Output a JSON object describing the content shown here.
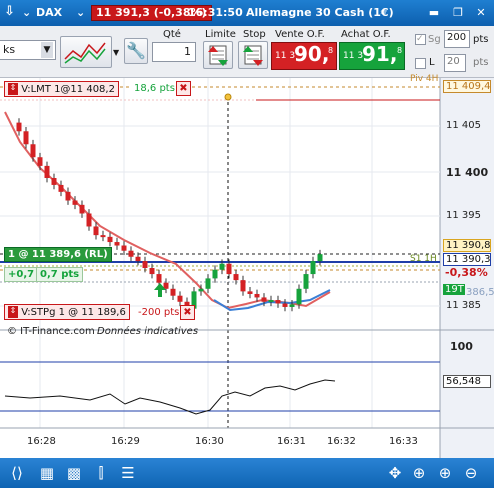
{
  "titlebar": {
    "symbol": "DAX",
    "quote": "11 391,3 (-0,38%)",
    "time": "16:31:50",
    "instrument": "Allemagne 30 Cash (1€)"
  },
  "toolbar": {
    "timeframe_value": "ks",
    "qty_label": "Qté",
    "qty_value": "1",
    "limit_label": "Limite",
    "stop_label": "Stop",
    "sell_label": "Vente O.F.",
    "buy_label": "Achat O.F.",
    "sell_price_small": "11 3",
    "sell_price_big": "90,",
    "sell_price_sup": "8",
    "buy_price_small": "11 3",
    "buy_price_big": "91,",
    "buy_price_sup": "8",
    "sg_label": "Sg",
    "sg_value": "200",
    "sg_unit": "pts",
    "l_label": "L",
    "l_value": "20",
    "l_unit": "pts"
  },
  "orders": {
    "limit_order": "V:LMT  1@11 408,2",
    "limit_pts": "18,6 pts",
    "position": "1 @ 11 389,6 (RL)",
    "position_pl": "+0,7",
    "position_pts": "0,7 pts",
    "stop_order": "V:STPg  1 @ 11 189,6",
    "stop_pts": "-200 pts"
  },
  "chart_labels": {
    "piv_label": "Piv 4H",
    "piv_value": "11 409,4",
    "s1_label": "S1 1H",
    "price_last": "11 390,8",
    "price_close": "11 390,3",
    "pct_change": "-0,38%",
    "timer": "19T",
    "s1_value": "386,5",
    "copyright": "© IT-Finance.com",
    "disclaimer": "Données indicatives",
    "osc_top": "100",
    "osc_value": "56,548"
  },
  "y_axis": [
    "11 405",
    "11 400",
    "11 395",
    "11 385"
  ],
  "x_axis": [
    "16:28",
    "16:29",
    "16:30",
    "16:31",
    "16:32",
    "16:33"
  ],
  "colors": {
    "up": "#16a33c",
    "down": "#d42124",
    "titlebar": "#1373c6"
  },
  "chart_data": {
    "type": "candlestick",
    "ylim": [
      11382.5,
      11410
    ],
    "x": [
      "16:28",
      "16:29",
      "16:30",
      "16:31",
      "16:32",
      "16:33"
    ],
    "last_price": 11390.3,
    "pivot_4h": 11409.4,
    "limit_order": 11408.2,
    "position_entry": 11389.6,
    "series": [
      {
        "name": "price",
        "values": [
          11406,
          11405,
          11403.5,
          11402,
          11401,
          11399.6,
          11398.8,
          11398,
          11397,
          11396.5,
          11395.5,
          11394,
          11393,
          11392.8,
          11392.2,
          11391.8,
          11391.2,
          11390.5,
          11390,
          11389.2,
          11388.5,
          11387.5,
          11386.8,
          11386,
          11385.3,
          11384.5,
          11386.5,
          11386.8,
          11388,
          11389,
          11389.7,
          11388.5,
          11387.8,
          11386.5,
          11386.2,
          11385.8,
          11385.3,
          11385.5,
          11385.1,
          11384.7,
          11385,
          11386.8,
          11388.5,
          11390,
          11390.8
        ]
      }
    ]
  }
}
